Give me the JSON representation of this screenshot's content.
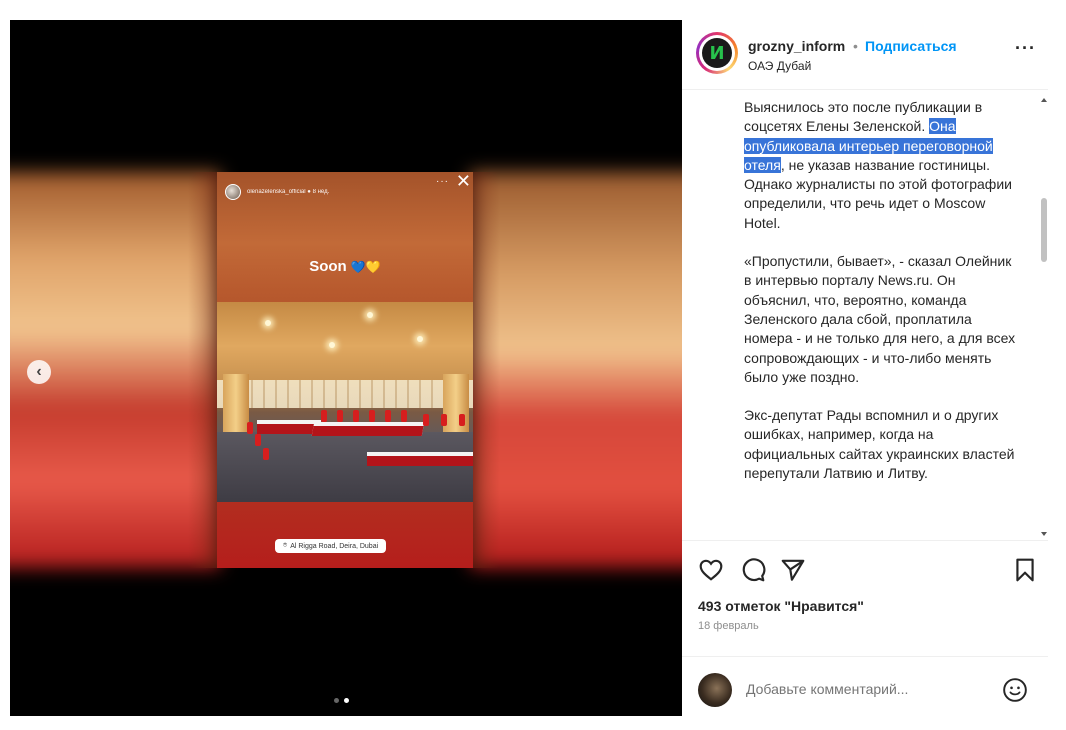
{
  "story": {
    "username": "olenazelenska_official",
    "time_ago": "8 нед.",
    "more_label": "···",
    "close_label": "✕",
    "caption": "Soon",
    "heart_blue": "💙",
    "heart_yellow": "💛",
    "location": "Al Rigga Road, Deira, Dubai",
    "location_icon": "pin-icon"
  },
  "carousel": {
    "prev_label": "‹",
    "slides": 2,
    "active_slide": 2
  },
  "header": {
    "username": "grozny_inform",
    "separator": "•",
    "follow_label": "Подписаться",
    "location": "ОАЭ Дубай",
    "more_label": "···",
    "avatar_letter": "И"
  },
  "caption": {
    "p1_before": "Выяснилось это после публикации в соцсетях Елены Зеленской. ",
    "p1_highlight": "Она опубликовала интерьер переговорной отеля",
    "p1_after": ", не указав название гостиницы. Однако журналисты по этой фотографии определили, что речь идет о Moscow Hotel.",
    "p2": "«Пропустили, бывает», - сказал Олейник в интервью порталу News.ru. Он объяснил, что, вероятно, команда Зеленского дала сбой, проплатила номера - и не только для него, а для всех сопровождающих - и что-либо менять было уже поздно.",
    "p3": "Экс-депутат Рады вспомнил и о других ошибках, например, когда на официальных сайтах украинских властей перепутали Латвию и Литву."
  },
  "actions": {
    "like_icon": "heart-icon",
    "comment_icon": "comment-icon",
    "share_icon": "send-icon",
    "save_icon": "bookmark-icon"
  },
  "stats": {
    "likes": "493 отметок \"Нравится\"",
    "date": "18 февраль"
  },
  "comment": {
    "placeholder": "Добавьте комментарий...",
    "emoji_icon": "smiley-icon"
  }
}
